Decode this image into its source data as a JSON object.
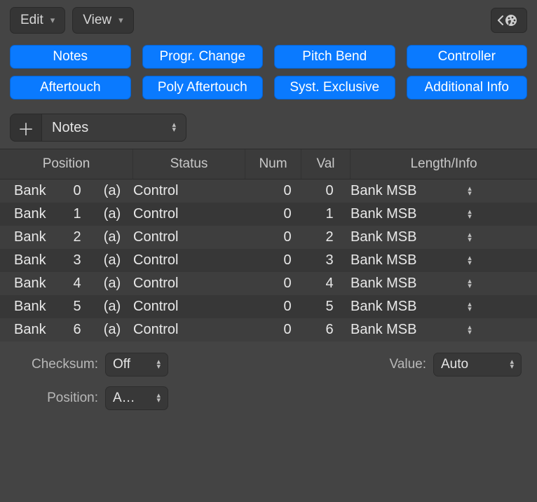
{
  "toolbar": {
    "edit_label": "Edit",
    "view_label": "View"
  },
  "filters": {
    "row1": [
      {
        "label": "Notes"
      },
      {
        "label": "Progr. Change"
      },
      {
        "label": "Pitch Bend"
      },
      {
        "label": "Controller"
      }
    ],
    "row2": [
      {
        "label": "Aftertouch"
      },
      {
        "label": "Poly Aftertouch"
      },
      {
        "label": "Syst. Exclusive"
      },
      {
        "label": "Additional Info"
      }
    ]
  },
  "add_bar": {
    "type_label": "Notes"
  },
  "table": {
    "headers": {
      "position": "Position",
      "status": "Status",
      "num": "Num",
      "val": "Val",
      "length": "Length/Info"
    },
    "rows": [
      {
        "bank": "Bank",
        "idx": "0",
        "a": "(a)",
        "status": "Control",
        "num": "0",
        "val": "0",
        "info": "Bank MSB"
      },
      {
        "bank": "Bank",
        "idx": "1",
        "a": "(a)",
        "status": "Control",
        "num": "0",
        "val": "1",
        "info": "Bank MSB"
      },
      {
        "bank": "Bank",
        "idx": "2",
        "a": "(a)",
        "status": "Control",
        "num": "0",
        "val": "2",
        "info": "Bank MSB"
      },
      {
        "bank": "Bank",
        "idx": "3",
        "a": "(a)",
        "status": "Control",
        "num": "0",
        "val": "3",
        "info": "Bank MSB"
      },
      {
        "bank": "Bank",
        "idx": "4",
        "a": "(a)",
        "status": "Control",
        "num": "0",
        "val": "4",
        "info": "Bank MSB"
      },
      {
        "bank": "Bank",
        "idx": "5",
        "a": "(a)",
        "status": "Control",
        "num": "0",
        "val": "5",
        "info": "Bank MSB"
      },
      {
        "bank": "Bank",
        "idx": "6",
        "a": "(a)",
        "status": "Control",
        "num": "0",
        "val": "6",
        "info": "Bank MSB"
      }
    ]
  },
  "footer": {
    "checksum_label": "Checksum:",
    "checksum_value": "Off",
    "value_label": "Value:",
    "value_value": "Auto",
    "position_label": "Position:",
    "position_value": "A…"
  }
}
